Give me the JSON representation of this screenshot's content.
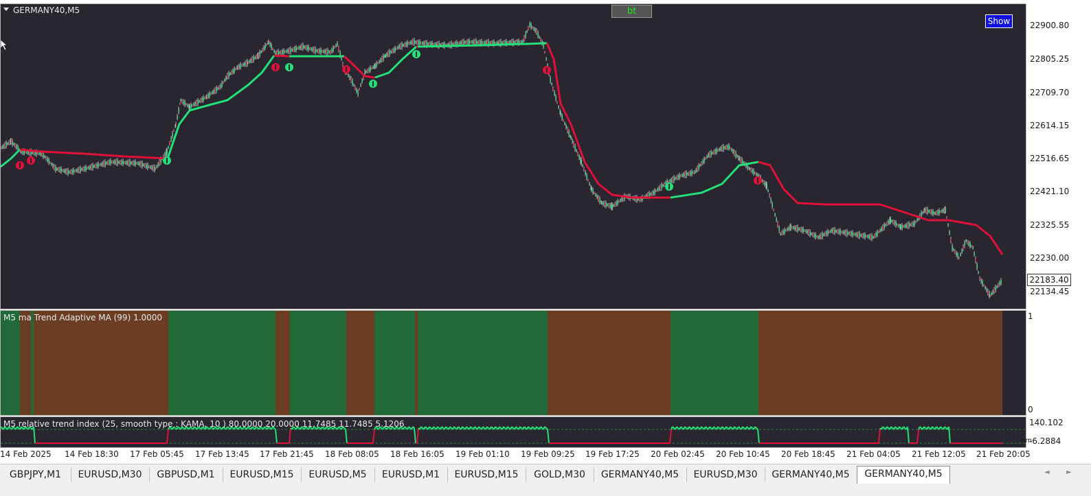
{
  "chart": {
    "symbol_label": "GERMANY40,M5",
    "price_labels": [
      "22900.80",
      "22805.25",
      "22709.70",
      "22614.15",
      "22516.65",
      "22421.10",
      "22325.55",
      "22230.00",
      "22134.45"
    ],
    "current_price": "22183.40",
    "show_button": "Show",
    "bt_button": "bt",
    "colors": {
      "background": "#2a2630",
      "up": "#22e07a",
      "down": "#e0103a",
      "bull_bar": "#22693a",
      "bear_bar": "#6b3e24"
    }
  },
  "indicator1": {
    "label": "M5 ma Trend Adaptive MA (99) 1.0000",
    "scale_top": "1",
    "scale_bottom": "0",
    "segments": [
      {
        "from": 0,
        "to": 28,
        "state": "up"
      },
      {
        "from": 28,
        "to": 44,
        "state": "down"
      },
      {
        "from": 44,
        "to": 48,
        "state": "up"
      },
      {
        "from": 48,
        "to": 244,
        "state": "down"
      },
      {
        "from": 244,
        "to": 400,
        "state": "up"
      },
      {
        "from": 400,
        "to": 421,
        "state": "down"
      },
      {
        "from": 421,
        "to": 503,
        "state": "up"
      },
      {
        "from": 503,
        "to": 544,
        "state": "down"
      },
      {
        "from": 544,
        "to": 603,
        "state": "up"
      },
      {
        "from": 603,
        "to": 607,
        "state": "down"
      },
      {
        "from": 607,
        "to": 796,
        "state": "up"
      },
      {
        "from": 796,
        "to": 975,
        "state": "down"
      },
      {
        "from": 975,
        "to": 1103,
        "state": "up"
      },
      {
        "from": 1103,
        "to": 1458,
        "state": "down"
      }
    ]
  },
  "indicator2": {
    "label": "M5 relative trend index (25, smooth type : KAMA, 10 ) 80.0000 20.0000 11.7485 11.7485 5.1206",
    "scale_top": "140.102",
    "scale_bottom": "-6.2884",
    "scale_marker": "nm"
  },
  "time_axis": [
    "14 Feb 2025",
    "14 Feb 18:30",
    "17 Feb 05:45",
    "17 Feb 13:45",
    "17 Feb 21:45",
    "18 Feb 08:05",
    "18 Feb 16:05",
    "19 Feb 01:10",
    "19 Feb 09:25",
    "19 Feb 17:25",
    "20 Feb 02:45",
    "20 Feb 10:45",
    "20 Feb 18:45",
    "21 Feb 04:05",
    "21 Feb 12:05",
    "21 Feb 20:05"
  ],
  "tabs": [
    "GBPJPY,M1",
    "EURUSD,M30",
    "GBPUSD,M1",
    "EURUSD,M15",
    "EURUSD,M5",
    "EURUSD,M1",
    "EURUSD,M15",
    "GOLD,M30",
    "GERMANY40,M5",
    "EURUSD,M30",
    "GERMANY40,M5",
    "GERMANY40,M5"
  ],
  "active_tab_index": 11,
  "tab_scroll": {
    "left": "◄",
    "right": "►"
  }
}
